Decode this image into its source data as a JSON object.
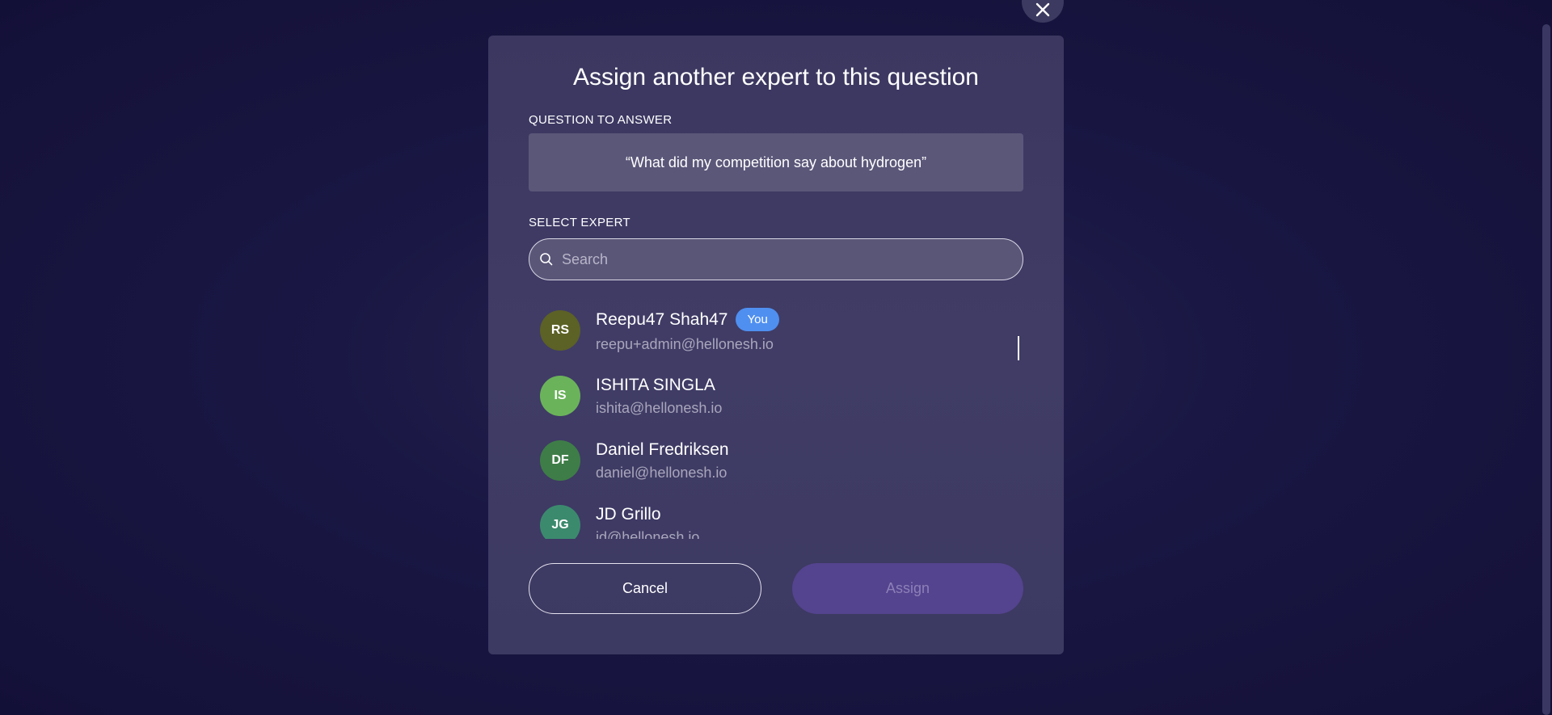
{
  "modal": {
    "title": "Assign another expert to this question",
    "question_label": "QUESTION TO ANSWER",
    "question_text": "“What did my competition say about hydrogen”",
    "select_label": "SELECT EXPERT",
    "search_placeholder": "Search",
    "search_value": "",
    "experts": [
      {
        "initials": "RS",
        "name": "Reepu47 Shah47",
        "badge": "You",
        "email": "reepu+admin@hellonesh.io",
        "color": "#5c6125"
      },
      {
        "initials": "IS",
        "name": "ISHITA SINGLA",
        "badge": "",
        "email": "ishita@hellonesh.io",
        "color": "#6bb35a"
      },
      {
        "initials": "DF",
        "name": "Daniel Fredriksen",
        "badge": "",
        "email": "daniel@hellonesh.io",
        "color": "#3e7d47"
      },
      {
        "initials": "JG",
        "name": "JD Grillo",
        "badge": "",
        "email": "jd@hellonesh.io",
        "color": "#3c8a6e"
      }
    ],
    "cancel_label": "Cancel",
    "assign_label": "Assign"
  },
  "icons": {
    "close": "close-icon",
    "search": "search-icon"
  },
  "colors": {
    "background": "#1a1744",
    "modal": "#3d3963",
    "you_badge": "#4f8ff0",
    "assign_button": "#54438e"
  }
}
